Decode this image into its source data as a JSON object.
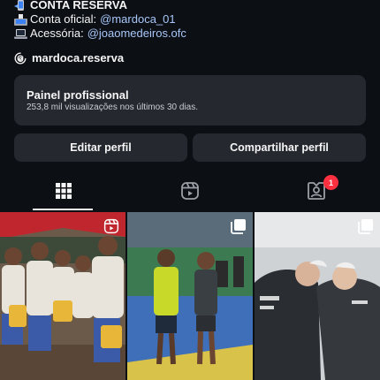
{
  "bio": {
    "line1": "CONTA RESERVA",
    "line2_prefix": "Conta oficial:",
    "line2_link": "@mardoca_01",
    "line3_prefix": "Acessória:",
    "line3_link": "@joaomedeiros.ofc"
  },
  "threads": {
    "handle": "mardoca.reserva",
    "icon": "threads-icon"
  },
  "panel": {
    "title": "Painel profissional",
    "subtitle": "253,8 mil visualizações nos últimos 30 dias."
  },
  "buttons": {
    "edit": "Editar perfil",
    "share": "Compartilhar perfil"
  },
  "tabs": [
    {
      "icon": "grid-icon",
      "active": true
    },
    {
      "icon": "reels-icon",
      "active": false
    },
    {
      "icon": "tagged-icon",
      "active": false,
      "badge": "1"
    }
  ],
  "posts": [
    {
      "icon": "reel-icon",
      "scene": "group-event-photo"
    },
    {
      "icon": "multi-image-icon",
      "scene": "futsal-court-photo"
    },
    {
      "icon": "multi-image-icon",
      "scene": "fighters-photo"
    }
  ],
  "colors": {
    "background": "#0c0f14",
    "surface": "#25292f",
    "link": "#a8c7fa",
    "badge": "#ff3040"
  }
}
